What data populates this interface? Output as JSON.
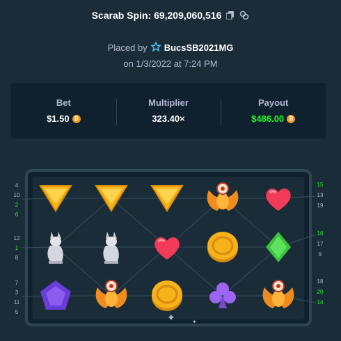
{
  "header": {
    "title": "Scarab Spin: 69,209,060,516",
    "copy_icon": "copy-icon",
    "link_icon": "link-icon"
  },
  "placed": {
    "prefix": "Placed by",
    "user_icon": "star-icon",
    "username": "BucsSB2021MG",
    "date": "on 1/3/2022 at 7:24 PM"
  },
  "stats": {
    "bet_label": "Bet",
    "bet_value": "$1.50",
    "multiplier_label": "Multiplier",
    "multiplier_value": "323.40×",
    "payout_label": "Payout",
    "payout_value": "$486.00",
    "currency_icon": "bitcoin-icon",
    "currency_symbol": "₿",
    "currency_color": "#f7931a",
    "payout_color": "#1fff20"
  },
  "board": {
    "grid": [
      [
        "triangle-gold",
        "triangle-gold",
        "triangle-gold",
        "scarab",
        "heart-red"
      ],
      [
        "cat-statue",
        "cat-statue",
        "heart-red",
        "coin-gold",
        "diamond-green"
      ],
      [
        "pentagon-purple",
        "scarab",
        "coin-gold",
        "club-purple",
        "scarab"
      ]
    ],
    "left_paylines": [
      [
        "4",
        "10",
        "2",
        "6"
      ],
      [
        "12",
        "1",
        "8"
      ],
      [
        "7",
        "3",
        "11",
        "5"
      ]
    ],
    "right_paylines": [
      [
        "15",
        "13",
        "19"
      ],
      [
        "16",
        "17",
        "9"
      ],
      [
        "18",
        "20",
        "14"
      ]
    ],
    "highlighted_paylines": [
      "2",
      "6",
      "1",
      "15",
      "16",
      "20",
      "14"
    ]
  }
}
